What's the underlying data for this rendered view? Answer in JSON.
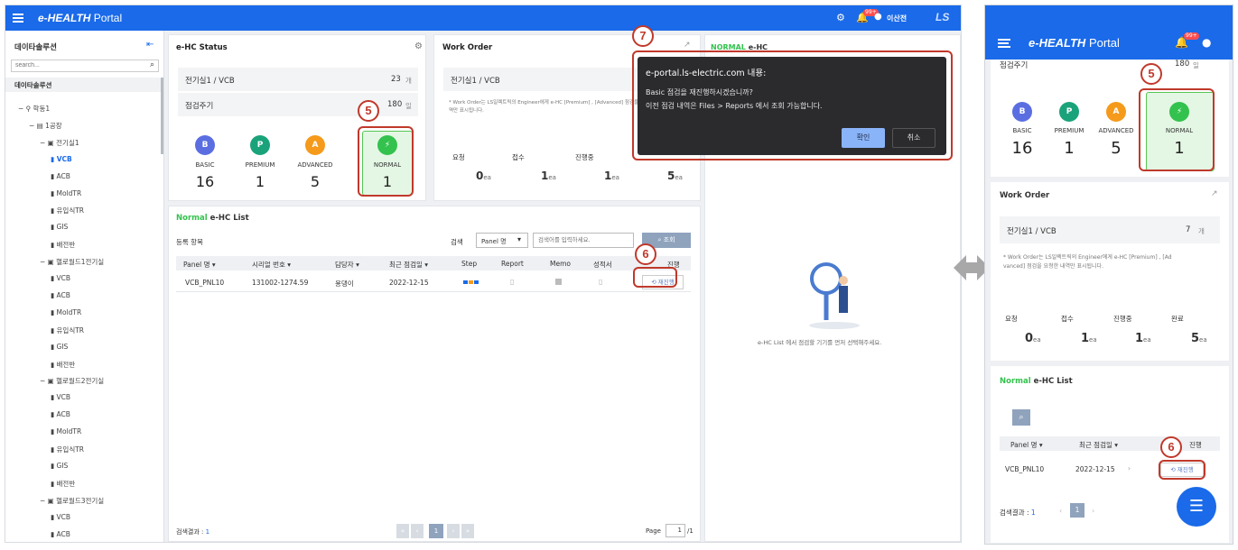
{
  "app": {
    "logo_e": "e-",
    "logo_main": "HEALTH",
    "logo_portal": "Portal",
    "user": "이산전",
    "badge": "99+",
    "brand": "LS"
  },
  "sidebar": {
    "title": "데이타솔루션",
    "search_placeholder": "search...",
    "root": "데이타솔루션",
    "nodes": [
      {
        "label": "학동1"
      },
      {
        "label": "1공장"
      },
      {
        "label": "전기실1"
      },
      {
        "label": "VCB"
      },
      {
        "label": "ACB"
      },
      {
        "label": "MoldTR"
      },
      {
        "label": "유입식TR"
      },
      {
        "label": "GIS"
      },
      {
        "label": "배전반"
      },
      {
        "label": "헬로월드1전기실"
      },
      {
        "label": "VCB"
      },
      {
        "label": "ACB"
      },
      {
        "label": "MoldTR"
      },
      {
        "label": "유입식TR"
      },
      {
        "label": "GIS"
      },
      {
        "label": "배전반"
      },
      {
        "label": "헬로월드2전기실"
      },
      {
        "label": "VCB"
      },
      {
        "label": "ACB"
      },
      {
        "label": "MoldTR"
      },
      {
        "label": "유입식TR"
      },
      {
        "label": "GIS"
      },
      {
        "label": "배전반"
      },
      {
        "label": "헬로월드3전기실"
      },
      {
        "label": "VCB"
      },
      {
        "label": "ACB"
      }
    ]
  },
  "status": {
    "title": "e-HC Status",
    "location": "전기실1 / VCB",
    "count": "23",
    "count_unit": "개",
    "period_label": "점검주기",
    "period_value": "180",
    "period_unit": "일",
    "plans": [
      {
        "letter": "B",
        "name": "BASIC",
        "count": "16"
      },
      {
        "letter": "P",
        "name": "PREMIUM",
        "count": "1"
      },
      {
        "letter": "A",
        "name": "ADVANCED",
        "count": "5"
      },
      {
        "letter": "⚡",
        "name": "NORMAL",
        "count": "1"
      }
    ]
  },
  "work_order": {
    "title": "Work Order",
    "location": "전기실1 / VCB",
    "count": "7",
    "count_unit": "개",
    "note_short": "* Work Order는 LS일렉트릭의 Engineer에게 e-HC [Premium] , [Advanced] 점검을",
    "note_short2": "역만 표시됩니다.",
    "note_full": "* Work Order는 LS일렉트릭의 Engineer에게 e-HC [Premium] , [Ad",
    "note_full2": "vanced] 점검을 요청한 내역만 표시됩니다.",
    "stats": [
      {
        "label": "요청",
        "value": "0",
        "unit": "ea"
      },
      {
        "label": "접수",
        "value": "1",
        "unit": "ea"
      },
      {
        "label": "진행중",
        "value": "1",
        "unit": "ea"
      },
      {
        "label": "완료",
        "value": "5",
        "unit": "ea"
      }
    ]
  },
  "list": {
    "title_green": "Normal",
    "title": "e-HC List",
    "reg_label": "등록 항목",
    "search_label": "검색",
    "select_value": "Panel 명",
    "search_placeholder": "검색어를 입력하세요.",
    "search_btn": "조회",
    "headers": [
      "Panel 명",
      "시리얼 번호",
      "담당자",
      "최근 점검일",
      "Step",
      "Report",
      "Memo",
      "성적서",
      "진행"
    ],
    "row": {
      "panel": "VCB_PNL10",
      "serial": "131002-1274.59",
      "manager": "용댕이",
      "date": "2022-12-15",
      "action": "재진행"
    },
    "result_label": "검색결과 :",
    "result_value": "1",
    "page_label": "Page",
    "page_value": "1",
    "page_total": "/1",
    "current_page": "1"
  },
  "normal_panel": {
    "title_green": "NORMAL",
    "title": "e-HC",
    "hint": "e-HC List 에서 점검할 기기를 먼저 선택해주세요."
  },
  "dialog": {
    "title": "e-portal.ls-electric.com 내용:",
    "line1": "Basic 점검을 재진행하시겠습니까?",
    "line2": "이전 점검 내역은 Files > Reports 에서 조회 가능합니다.",
    "ok": "확인",
    "cancel": "취소"
  },
  "mobile": {
    "list_headers": [
      "Panel 명",
      "최근 점검일",
      "진행"
    ],
    "row": {
      "panel": "VCB_PNL10",
      "date": "2022-12-15",
      "action": "재진행"
    },
    "result_label": "검색결과 :",
    "result_value": "1",
    "page": "1"
  },
  "callouts": {
    "five": "5",
    "six": "6",
    "seven": "7"
  },
  "colors": {
    "accent": "#1a6ae9",
    "basic": "#5b6ee1",
    "premium": "#1aa37a",
    "advanced": "#f59a1b",
    "normal": "#33c24d",
    "callout": "#c0392b"
  }
}
